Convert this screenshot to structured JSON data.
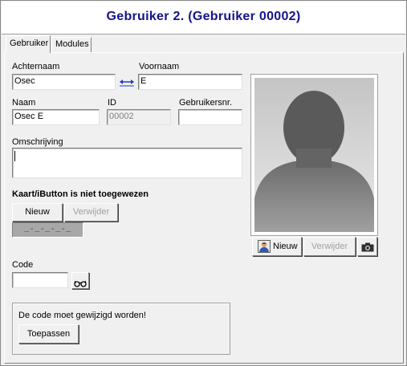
{
  "window": {
    "title": "Gebruiker 2.  (Gebruiker  00002)"
  },
  "tabs": [
    {
      "label": "Gebruiker",
      "active": true
    },
    {
      "label": "Modules",
      "active": false
    }
  ],
  "form": {
    "achternaam_label": "Achternaam",
    "achternaam_value": "Osec",
    "voornaam_label": "Voornaam",
    "voornaam_value": "E",
    "naam_label": "Naam",
    "naam_value": "Osec E",
    "id_label": "ID",
    "id_value": "00002",
    "gebruikersnr_label": "Gebruikersnr.",
    "gebruikersnr_value": "",
    "omschrijving_label": "Omschrijving",
    "omschrijving_value": ""
  },
  "card": {
    "status_text": "Kaart/iButton is niet toegewezen",
    "new_label": "Nieuw",
    "delete_label": "Verwijder",
    "card_number": "_-_-_-_-_"
  },
  "code": {
    "label": "Code",
    "value": "",
    "show_icon": "glasses-icon"
  },
  "notice": {
    "text": "De code moet gewijzigd worden!",
    "apply_label": "Toepassen"
  },
  "photo": {
    "new_label": "Nieuw",
    "delete_label": "Verwijder",
    "new_icon": "user-photo-icon",
    "camera_icon": "camera-icon"
  },
  "colors": {
    "title": "#14148c",
    "swap_arrow": "#1c3cc8"
  }
}
